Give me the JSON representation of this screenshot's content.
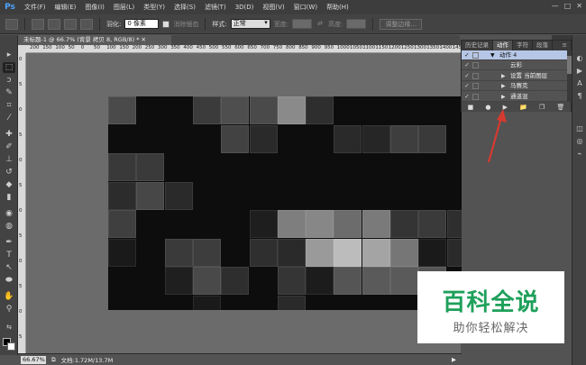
{
  "app": {
    "logo": "Ps"
  },
  "menubar": {
    "items": [
      "文件(F)",
      "编辑(E)",
      "图像(I)",
      "图层(L)",
      "类型(Y)",
      "选择(S)",
      "滤镜(T)",
      "3D(D)",
      "视图(V)",
      "窗口(W)",
      "帮助(H)"
    ],
    "window_controls": [
      "—",
      "□",
      "✕"
    ]
  },
  "options_bar": {
    "feather_label": "羽化:",
    "feather_value": "0 像素",
    "antialias_label": "消除锯齿",
    "style_label": "样式:",
    "style_value": "正常",
    "width_label": "宽度:",
    "height_label": "高度:",
    "refine_edge_label": "调整边缘..."
  },
  "document": {
    "tab_title": "未标题-1 @ 66.7% (背景 拷贝 8, RGB/8) *  ✕",
    "zoom": "66.67%",
    "doc_info": "文档:1.72M/13.7M"
  },
  "ruler": {
    "h_ticks": [
      "200",
      "150",
      "100",
      "50",
      "0",
      "50",
      "100",
      "150",
      "200",
      "250",
      "300",
      "350",
      "400",
      "450",
      "500",
      "550",
      "600",
      "650",
      "700",
      "750",
      "800",
      "850",
      "900",
      "950",
      "1000",
      "1050",
      "1100",
      "1150",
      "1200",
      "1250",
      "1300",
      "1350",
      "1400",
      "1450"
    ],
    "v_ticks": [
      "0",
      "5",
      "0",
      "5",
      "0",
      "5",
      "0",
      "5",
      "0",
      "5",
      "0",
      "5"
    ]
  },
  "actions_panel": {
    "tabs": [
      "历史记录",
      "动作",
      "字符",
      "段落"
    ],
    "active_tab": "动作",
    "rows": [
      {
        "check": "✓",
        "label": "动作 4",
        "expanded": true,
        "selected": true,
        "indent": 1
      },
      {
        "check": "✓",
        "label": "云彩",
        "expanded": false,
        "selected": false,
        "indent": 2
      },
      {
        "check": "✓",
        "label": "设置 当前图层",
        "expanded": false,
        "selected": false,
        "indent": 2
      },
      {
        "check": "✓",
        "label": "马赛克",
        "expanded": false,
        "selected": false,
        "indent": 2
      },
      {
        "check": "✓",
        "label": "通道混",
        "expanded": false,
        "selected": false,
        "indent": 2
      }
    ],
    "bottom_buttons": [
      "■",
      "●",
      "▶",
      "📁",
      "❐",
      "🗑"
    ]
  },
  "watermark": {
    "title": "百科全说",
    "subtitle": "助你轻松解决"
  },
  "colors": {
    "accent_arrow": "#d63a2f",
    "watermark_green": "#1ea05a"
  }
}
